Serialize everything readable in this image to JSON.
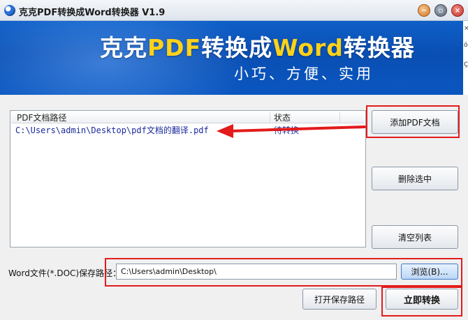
{
  "window": {
    "title": "克克PDF转换成Word转换器 V1.9",
    "controls": [
      "minimize",
      "maximize",
      "close"
    ]
  },
  "banner": {
    "title_part1": "克克",
    "title_part2": "PDF",
    "title_part3": "转换成",
    "title_part4": "Word",
    "title_part5": "转换器",
    "subtitle": "小巧、方便、实用",
    "edge_glyphs": [
      "×",
      "ö",
      "Ç"
    ]
  },
  "file_list": {
    "columns": [
      "PDF文档路径",
      "状态"
    ],
    "rows": [
      {
        "path": "C:\\Users\\admin\\Desktop\\pdf文档的翻译.pdf",
        "status": "待转换"
      }
    ]
  },
  "buttons": {
    "add_pdf": "添加PDF文档",
    "delete_selected": "删除选中",
    "clear_list": "清空列表",
    "browse": "浏览(B)...",
    "open_save_path": "打开保存路径",
    "convert_now": "立即转换"
  },
  "save_path": {
    "label": "Word文件(*.DOC)保存路径：",
    "value": "C:\\Users\\admin\\Desktop\\"
  },
  "colors": {
    "banner_blue": "#0a4fb3",
    "highlight_yellow": "#ffd21a",
    "annotation_red": "#e31b1b",
    "list_text_blue": "#1a2a9a"
  }
}
